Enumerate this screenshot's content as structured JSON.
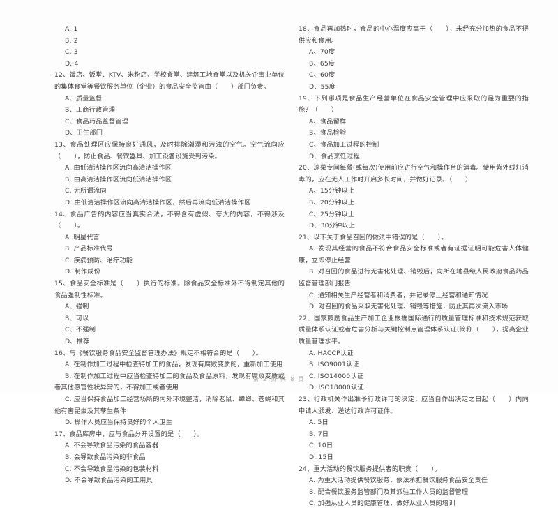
{
  "document": {
    "page_background": "#fdfdfd",
    "text_color": "#43403f",
    "footer": "第 2 页 共 8 页"
  },
  "left_column": {
    "leading_options": [
      "A. 1",
      "B. 2",
      "C. 3",
      "D. 4"
    ],
    "questions": [
      {
        "number": "12",
        "stem": "12、饭店、饭堂、KTV、米粉店、学校食堂、建筑工地食堂以及机关企事业单位的集体食堂等餐饮服务单位（企业）的食品安全监管由（　　）部门负责。",
        "options": [
          "A、质量监督",
          "B、工商行政管理",
          "C、食品药品监督管理",
          "D、卫生部门"
        ]
      },
      {
        "number": "13",
        "stem": "13、食品处理区应保持良好通风，及时排除潮湿和污浊的空气。空气流向应（　　），防止食品、餐饮器具、加工设备设施受到污染。",
        "options": [
          "A. 由低清洁操作区流向高清洁操作区",
          "B. 由高清洁操作区流向低清洁操作区",
          "C. 无所谓流向",
          "D. 由低清洁操作区流向高清洁操作区，然后再流向低清洁操作区"
        ]
      },
      {
        "number": "14",
        "stem": "14、食品广告的内容应当真实合法，不得含有虚假、夸大的内容，不得涉及（　　）。",
        "options": [
          "A. 明星代言",
          "B. 产品标准代号",
          "C. 疾病预防、治疗功能",
          "D. 制作成份"
        ]
      },
      {
        "number": "15",
        "stem": "15、食品安全标准是（　　）执行的标准。除食品安全标准外不得制定其他的食品强制性标准。",
        "options": [
          "A、强制",
          "B、可以",
          "C、不强制",
          "D、推荐"
        ]
      },
      {
        "number": "16",
        "stem": "16、与《餐饮服务食品安全监督管理办法》规定不相符合的是（　　）。",
        "options": [
          "A. 在制作加工过程中检查待加工的食品，发现有腐败变质的，重新加工使用",
          "B. 在制作加工过程中应当检查待加工的食品及食品原料，发现有腐败变质或者其他感官性状异常的，不得加工或者使用",
          "C. 应当保持食品加工经营场所的内外环境整洁，消除老鼠、蟑螂、苍蝇和其他有害昆虫及其孳生条件",
          "D. 操作人员应当保持良好的个人卫生"
        ]
      },
      {
        "number": "17",
        "stem": "17、食品库房中，应与食品分开设置的是（　　）。",
        "options": [
          "A. 不会导致食品污染的食品容器",
          "B. 会导致食品污染的非食品",
          "C. 不会导致食品污染的包装材料",
          "D. 不会导致食品污染的工用具"
        ]
      }
    ]
  },
  "right_column": {
    "questions": [
      {
        "number": "18",
        "stem": "18、食品再加热时，食品的中心温度应高于（　　），未经充分加热的食品不得供应和食用。",
        "options": [
          "A、70度",
          "B、65度",
          "C、60度",
          "D、55度"
        ]
      },
      {
        "number": "19",
        "stem": "19、下列哪项是食品生产经营单位在食品安全管理中应采取的最为重要的措施？（　　）",
        "options": [
          "A、食品留样",
          "B、食品检验",
          "C、食品加工过程的控制",
          "D、食品烹饪过程"
        ]
      },
      {
        "number": "20",
        "stem": "20、凉菜专间每餐(或每次)使用前应进行空气和操作台的消毒。使用紫外线灯消毒的，应在无人工作时开启多长时间，并做好记录。（　　）",
        "options": [
          "A、15分钟以上",
          "B、20分钟以上",
          "C、25分钟以上",
          "D、30分钟以上"
        ]
      },
      {
        "number": "21",
        "stem": "21、以下关于食品召回的做法中错误的是（　　）。",
        "options": [
          "A. 发现其经营的食品不符合食品安全标准或者有证据证明可能危害人体健康，立即停止经营",
          "B. 对召回的食品进行无害化处理、销毁后，向所在地县级人民政府食品药品监督管理部门报告",
          "C. 通知相关生产经营者和消费者，并记录停止经营和通知情况",
          "D. 对召回的食品采取无害化处理、销毁等措施，防止其再次流入市场"
        ]
      },
      {
        "number": "22",
        "stem": "22、国家鼓励食品生产加工企业根据国际通行的质量管理标准和技术规范获取质量体系认证或者危害分析与关键控制点管理体系认证(简称（　　），提高企业质量管理水平。",
        "options": [
          "A. HACCP认证",
          "B. ISO9001认证",
          "C. ISO14000认证",
          "D. ISO18000认证"
        ]
      },
      {
        "number": "23",
        "stem": "23、行政机关作出准予行政许可的决定，应当自作出决定之日起（　　）内向申请人颁发、送达行政许可证件。",
        "options": [
          "A. 5日",
          "B. 7日",
          "C. 10日",
          "D. 15日"
        ]
      },
      {
        "number": "24",
        "stem": "24、重大活动的餐饮服务提供者的职责（　　）。",
        "options": [
          "A. 为重大活动提供餐饮服务，依法承担餐饮服务食品安全责任",
          "B. 配合餐饮服务监管部门及其派驻工作人员的监督管理",
          "C. 加强从业人员的健康管理，做好从业人员的培训"
        ]
      }
    ]
  }
}
